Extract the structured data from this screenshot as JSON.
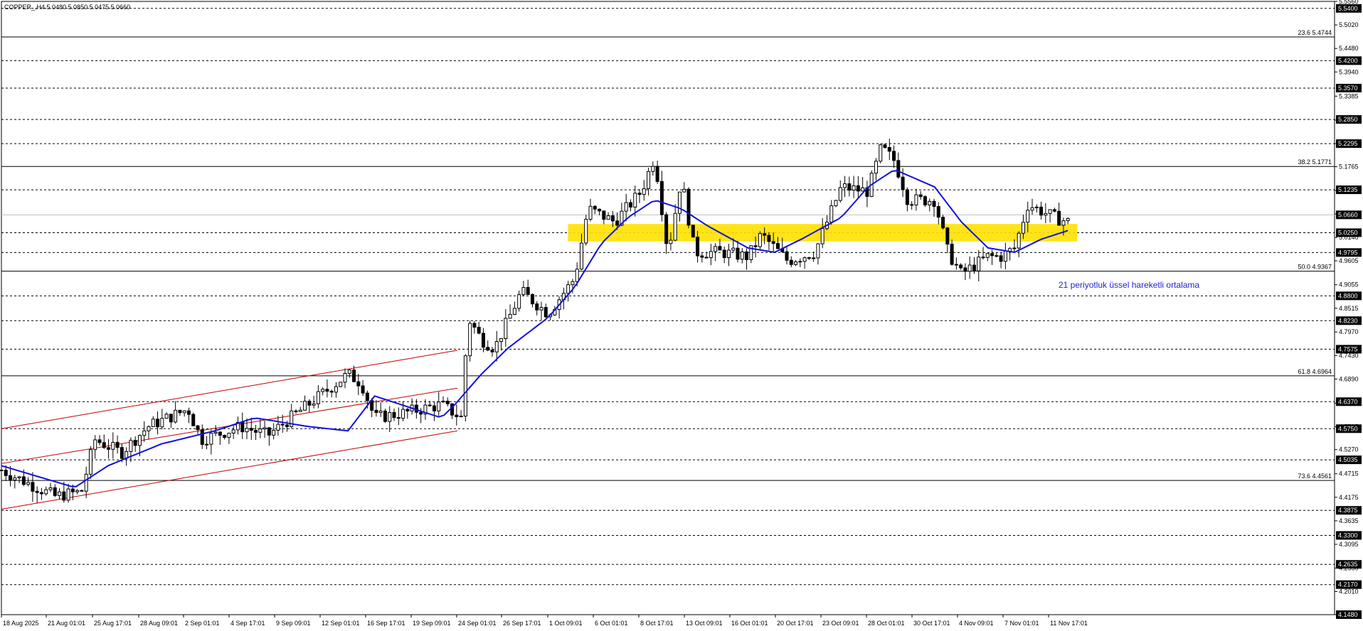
{
  "header": {
    "symbol": "COPPER_,H4",
    "ohlc": "5.0480 5.0850 5.0475 5.0660"
  },
  "annotation": "21 periyotluk üssel hareketli ortalama",
  "colors": {
    "background": "#ffffff",
    "candle": "#000000",
    "ema": "#1010e0",
    "zone": "#ffe100",
    "channel": "#c00000",
    "level_line": "#000000",
    "label_bg": "#000000"
  },
  "chart_data": {
    "type": "candlestick",
    "ylim": [
      4.148,
      5.556
    ],
    "y_ticks": [
      "5.5560",
      "5.5020",
      "5.4480",
      "5.3940",
      "5.3385",
      "5.2835",
      "5.2295",
      "5.1765",
      "5.1220",
      "5.0680",
      "5.0140",
      "4.9605",
      "4.9055",
      "4.8515",
      "4.7970",
      "4.7430",
      "4.6890",
      "4.6335",
      "4.5795",
      "4.5270",
      "4.4715",
      "4.4175",
      "4.3635",
      "4.3095",
      "4.2550",
      "4.2010",
      "4.1480"
    ],
    "x_ticks": [
      "18 Aug 2025",
      "21 Aug 01:01",
      "25 Aug 17:01",
      "28 Aug 09:01",
      "2 Sep 01:01",
      "4 Sep 17:01",
      "9 Sep 09:01",
      "12 Sep 01:01",
      "16 Sep 17:01",
      "19 Sep 09:01",
      "24 Sep 01:01",
      "26 Sep 17:01",
      "1 Oct 09:01",
      "6 Oct 01:01",
      "8 Oct 17:01",
      "13 Oct 09:01",
      "16 Oct 01:01",
      "20 Oct 17:01",
      "23 Oct 09:01",
      "28 Oct 01:01",
      "30 Oct 17:01",
      "4 Nov 09:01",
      "7 Nov 01:01",
      "11 Nov 17:01"
    ],
    "horizontal_levels": [
      5.54,
      5.42,
      5.357,
      5.285,
      5.2295,
      5.1235,
      5.025,
      4.9795,
      4.88,
      4.823,
      4.7575,
      4.637,
      4.575,
      4.5035,
      4.3875,
      4.33,
      4.2635,
      4.217,
      4.148
    ],
    "horizontal_level_labels": [
      "5.5400",
      "5.4200",
      "5.3570",
      "5.2850",
      "5.2295",
      "5.1235",
      "5.0250",
      "4.9795",
      "4.8800",
      "4.8230",
      "4.7575",
      "4.6370",
      "4.5750",
      "4.5035",
      "4.3875",
      "4.3300",
      "4.2635",
      "4.2170",
      "4.1480"
    ],
    "fibonacci_levels": [
      {
        "label": "23.6 5.4744",
        "value": 5.4744
      },
      {
        "label": "38.2 5.1771",
        "value": 5.1771
      },
      {
        "label": "50.0 4.9367",
        "value": 4.9367
      },
      {
        "label": "61.8 4.6964",
        "value": 4.6964
      },
      {
        "label": "73.6 4.4561",
        "value": 4.4561
      }
    ],
    "current_price": {
      "value": 5.066,
      "label": "5.0660"
    },
    "zone": {
      "from": 5.005,
      "to": 5.045,
      "x_start_label": "1 Oct 09:01",
      "x_end_label": "11 Nov 17:01"
    },
    "series": [
      {
        "name": "21 periyotluk üssel hareketli ortalama",
        "kind": "ema",
        "anchors": [
          [
            0,
            4.49
          ],
          [
            0.055,
            4.44
          ],
          [
            0.08,
            4.49
          ],
          [
            0.12,
            4.54
          ],
          [
            0.16,
            4.57
          ],
          [
            0.19,
            4.6
          ],
          [
            0.23,
            4.58
          ],
          [
            0.26,
            4.57
          ],
          [
            0.28,
            4.65
          ],
          [
            0.33,
            4.6
          ],
          [
            0.34,
            4.63
          ],
          [
            0.36,
            4.7
          ],
          [
            0.38,
            4.76
          ],
          [
            0.41,
            4.83
          ],
          [
            0.43,
            4.9
          ],
          [
            0.45,
            5.0
          ],
          [
            0.47,
            5.06
          ],
          [
            0.49,
            5.1
          ],
          [
            0.51,
            5.08
          ],
          [
            0.53,
            5.04
          ],
          [
            0.56,
            4.99
          ],
          [
            0.58,
            4.98
          ],
          [
            0.6,
            5.01
          ],
          [
            0.63,
            5.06
          ],
          [
            0.65,
            5.13
          ],
          [
            0.67,
            5.17
          ],
          [
            0.7,
            5.13
          ],
          [
            0.72,
            5.05
          ],
          [
            0.74,
            4.99
          ],
          [
            0.76,
            4.98
          ],
          [
            0.78,
            5.01
          ],
          [
            0.8,
            5.03
          ]
        ]
      },
      {
        "name": "",
        "kind": "price",
        "anchors": [
          [
            0,
            4.48
          ],
          [
            0.04,
            4.42
          ],
          [
            0.06,
            4.43
          ],
          [
            0.07,
            4.55
          ],
          [
            0.09,
            4.52
          ],
          [
            0.11,
            4.58
          ],
          [
            0.14,
            4.62
          ],
          [
            0.15,
            4.55
          ],
          [
            0.18,
            4.58
          ],
          [
            0.2,
            4.56
          ],
          [
            0.23,
            4.63
          ],
          [
            0.26,
            4.7
          ],
          [
            0.27,
            4.68
          ],
          [
            0.28,
            4.6
          ],
          [
            0.3,
            4.61
          ],
          [
            0.33,
            4.63
          ],
          [
            0.345,
            4.6
          ],
          [
            0.35,
            4.83
          ],
          [
            0.36,
            4.78
          ],
          [
            0.37,
            4.76
          ],
          [
            0.39,
            4.89
          ],
          [
            0.41,
            4.84
          ],
          [
            0.43,
            4.92
          ],
          [
            0.44,
            5.08
          ],
          [
            0.46,
            5.05
          ],
          [
            0.48,
            5.12
          ],
          [
            0.49,
            5.2
          ],
          [
            0.5,
            4.98
          ],
          [
            0.51,
            5.15
          ],
          [
            0.52,
            4.98
          ],
          [
            0.54,
            4.98
          ],
          [
            0.56,
            4.97
          ],
          [
            0.57,
            5.02
          ],
          [
            0.59,
            4.96
          ],
          [
            0.61,
            4.98
          ],
          [
            0.63,
            5.13
          ],
          [
            0.65,
            5.12
          ],
          [
            0.66,
            5.22
          ],
          [
            0.67,
            5.19
          ],
          [
            0.68,
            5.1
          ],
          [
            0.7,
            5.1
          ],
          [
            0.71,
            4.98
          ],
          [
            0.72,
            4.93
          ],
          [
            0.74,
            4.97
          ],
          [
            0.75,
            4.97
          ],
          [
            0.76,
            4.99
          ],
          [
            0.77,
            5.09
          ],
          [
            0.79,
            5.06
          ],
          [
            0.8,
            5.05
          ]
        ]
      }
    ],
    "channel_lines": [
      {
        "from": [
          0,
          4.575
        ],
        "to": [
          0.342,
          4.755
        ]
      },
      {
        "from": [
          0,
          4.495
        ],
        "to": [
          0.342,
          4.668
        ]
      },
      {
        "from": [
          0,
          4.39
        ],
        "to": [
          0.342,
          4.57
        ]
      }
    ]
  }
}
